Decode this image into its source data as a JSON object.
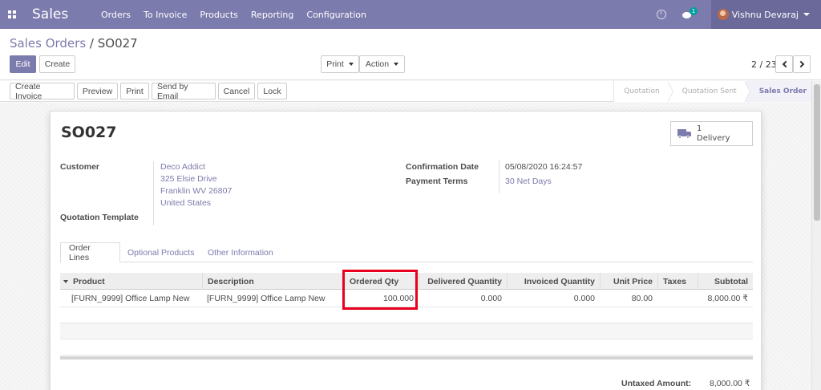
{
  "navbar": {
    "app_name": "Sales",
    "menu": [
      "Orders",
      "To Invoice",
      "Products",
      "Reporting",
      "Configuration"
    ],
    "chat_badge": "1",
    "user_name": "Vishnu Devaraj"
  },
  "control": {
    "breadcrumb_parent": "Sales Orders",
    "breadcrumb_sep": "/",
    "breadcrumb_current": "SO027",
    "edit_label": "Edit",
    "create_label": "Create",
    "print_label": "Print",
    "action_label": "Action",
    "pager": "2 / 23"
  },
  "statusbar": {
    "buttons": [
      "Create Invoice",
      "Preview",
      "Print",
      "Send by Email",
      "Cancel",
      "Lock"
    ],
    "stages": [
      "Quotation",
      "Quotation Sent",
      "Sales Order"
    ],
    "active_stage": "Sales Order"
  },
  "form": {
    "title": "SO027",
    "delivery_count": "1",
    "delivery_label": "Delivery",
    "customer_label": "Customer",
    "customer_name": "Deco Addict",
    "address_line1": "325 Elsie Drive",
    "address_line2": "Franklin WV 26807",
    "address_line3": "United States",
    "quotation_template_label": "Quotation Template",
    "confirmation_date_label": "Confirmation Date",
    "confirmation_date": "05/08/2020 16:24:57",
    "payment_terms_label": "Payment Terms",
    "payment_terms": "30 Net Days"
  },
  "tabs": [
    "Order Lines",
    "Optional Products",
    "Other Information"
  ],
  "table": {
    "headers": [
      "Product",
      "Description",
      "Ordered Qty",
      "Delivered Quantity",
      "Invoiced Quantity",
      "Unit Price",
      "Taxes",
      "Subtotal"
    ],
    "rows": [
      {
        "product": "[FURN_9999] Office Lamp New",
        "description": "[FURN_9999] Office Lamp New",
        "ordered_qty": "100.000",
        "delivered_qty": "0.000",
        "invoiced_qty": "0.000",
        "unit_price": "80.00",
        "taxes": "",
        "subtotal": "8,000.00 ₹"
      }
    ]
  },
  "totals": {
    "untaxed_label": "Untaxed Amount:",
    "untaxed_value": "8,000.00 ₹"
  },
  "colors": {
    "brand": "#7c7bad",
    "highlight": "#e8001c"
  }
}
